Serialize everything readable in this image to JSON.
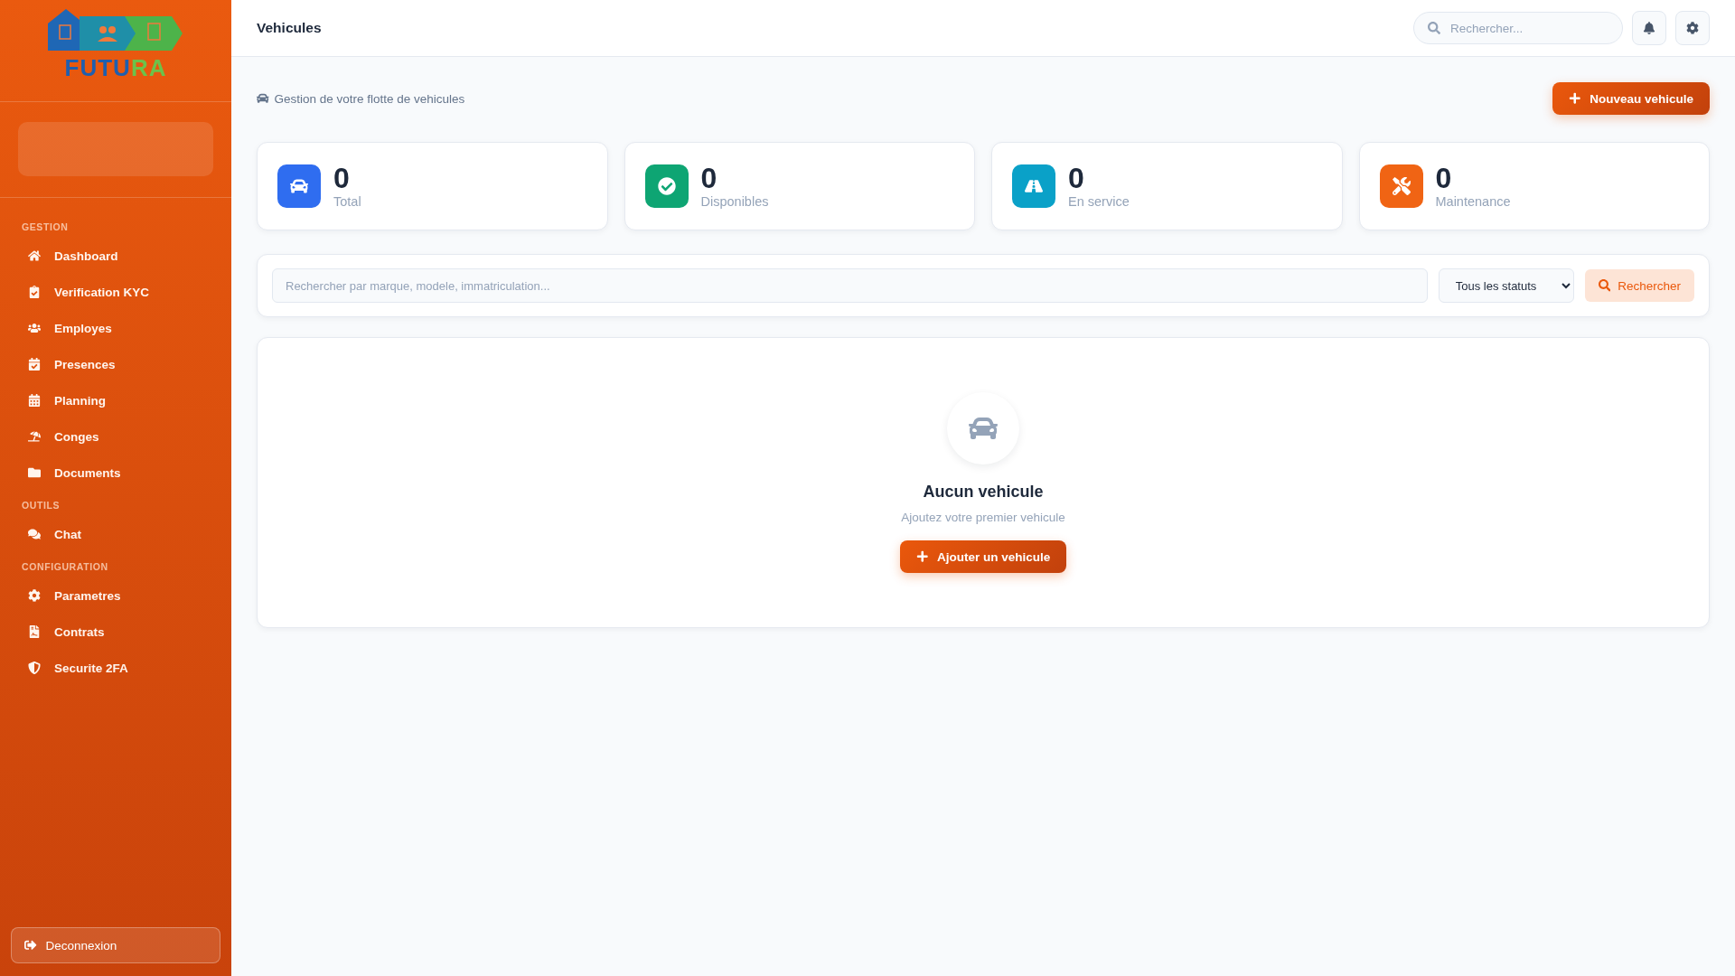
{
  "sidebar": {
    "logo": {
      "parts": [
        "FUTU",
        "RA"
      ]
    },
    "sections": [
      {
        "title": "GESTION",
        "items": [
          {
            "label": "Dashboard",
            "kind": "home"
          },
          {
            "label": "Verification KYC",
            "kind": "kyc"
          },
          {
            "label": "Employes",
            "kind": "users"
          },
          {
            "label": "Presences",
            "kind": "presence"
          },
          {
            "label": "Planning",
            "kind": "calendar"
          },
          {
            "label": "Conges",
            "kind": "beach"
          },
          {
            "label": "Documents",
            "kind": "folder"
          }
        ]
      },
      {
        "title": "OUTILS",
        "items": [
          {
            "label": "Chat",
            "kind": "chat"
          }
        ]
      },
      {
        "title": "CONFIGURATION",
        "items": [
          {
            "label": "Parametres",
            "kind": "gear"
          },
          {
            "label": "Contrats",
            "kind": "contract"
          },
          {
            "label": "Securite 2FA",
            "kind": "shield"
          }
        ]
      }
    ],
    "logout": "Deconnexion"
  },
  "header": {
    "title": "Vehicules",
    "search": {
      "placeholder": "Rechercher..."
    }
  },
  "subtitle": "Gestion de votre flotte de vehicules",
  "new_button": "Nouveau vehicule",
  "stats": [
    {
      "value": "0",
      "label": "Total",
      "kind": "total",
      "color": "#2f6df0"
    },
    {
      "value": "0",
      "label": "Disponibles",
      "kind": "available",
      "color": "#0ea573"
    },
    {
      "value": "0",
      "label": "En service",
      "kind": "service",
      "color": "#0aa1c8"
    },
    {
      "value": "0",
      "label": "Maintenance",
      "kind": "maintenance",
      "color": "#f06414"
    }
  ],
  "filter": {
    "placeholder": "Rechercher par marque, modele, immatriculation...",
    "status": "Tous les statuts",
    "button": "Rechercher"
  },
  "empty": {
    "title": "Aucun vehicule",
    "text": "Ajoutez votre premier vehicule",
    "button": "Ajouter un vehicule"
  }
}
